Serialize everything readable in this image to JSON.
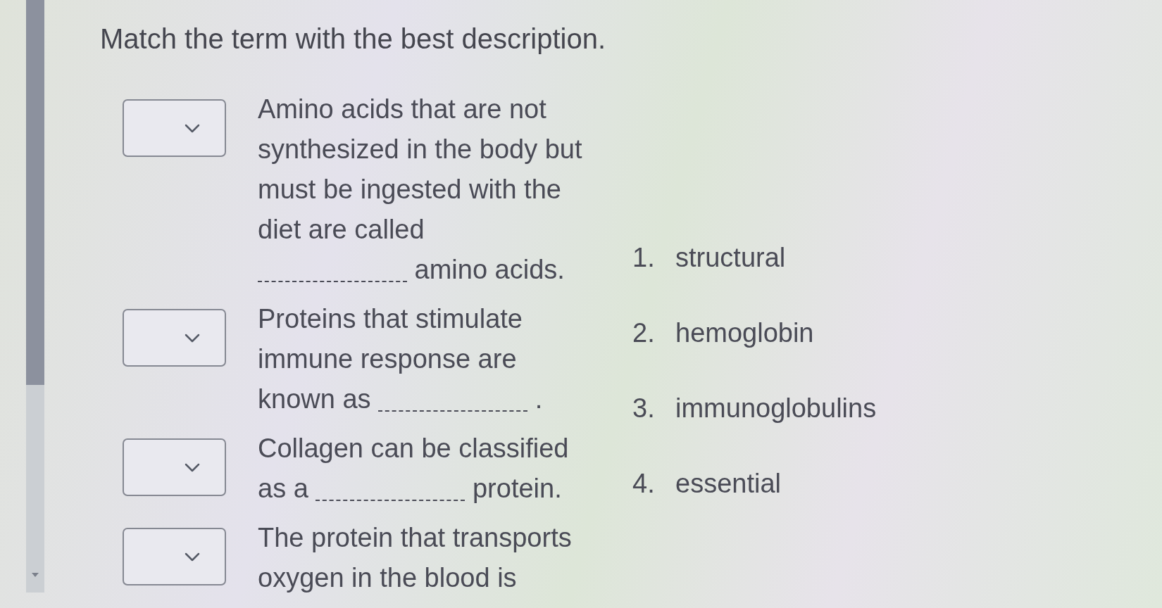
{
  "instruction": "Match the term with the best description.",
  "questions": [
    {
      "prompt": "Amino acids that are not synthesized in the body but must be ingested with the diet are called",
      "blank": true,
      "after_blank": "amino acids."
    },
    {
      "prompt": "Proteins that stimulate immune response are known as",
      "blank": true,
      "after_blank": "."
    },
    {
      "prompt": "Collagen can be classified as a",
      "blank": true,
      "after_blank": "protein."
    },
    {
      "prompt": "The protein that transports oxygen in the blood is",
      "blank": false
    }
  ],
  "answers": [
    {
      "number": "1.",
      "term": "structural"
    },
    {
      "number": "2.",
      "term": "hemoglobin"
    },
    {
      "number": "3.",
      "term": "immunoglobulins"
    },
    {
      "number": "4.",
      "term": "essential"
    }
  ]
}
